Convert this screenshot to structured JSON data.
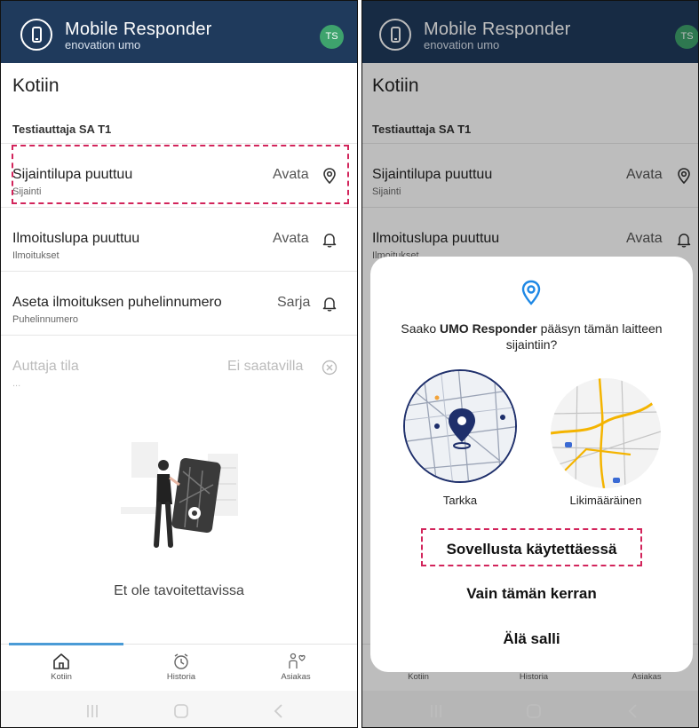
{
  "header": {
    "app_title": "Mobile Responder",
    "app_subtitle": "enovation umo",
    "avatar_initials": "TS",
    "bg_color": "#1f3a5c",
    "avatar_color": "#3ea36d"
  },
  "page": {
    "title": "Kotiin",
    "section_label": "Testiauttaja SA T1"
  },
  "rows": [
    {
      "title": "Sijaintilupa puuttuu",
      "subtitle": "Sijainti",
      "action": "Avata",
      "icon": "location-pin-icon"
    },
    {
      "title": "Ilmoituslupa puuttuu",
      "subtitle": "Ilmoitukset",
      "action": "Avata",
      "icon": "bell-icon"
    },
    {
      "title": "Aseta ilmoituksen puhelinnumero",
      "subtitle": "Puhelinnumero",
      "action": "Sarja",
      "icon": "bell-icon"
    },
    {
      "title": "Auttaja tila",
      "subtitle": "...",
      "action": "Ei saatavilla",
      "icon": "circle-x-icon",
      "disabled": true
    }
  ],
  "empty_state": {
    "text": "Et ole tavoitettavissa"
  },
  "bottom_nav": [
    {
      "label": "Kotiin",
      "icon": "home-icon",
      "active": true
    },
    {
      "label": "Historia",
      "icon": "clock-icon"
    },
    {
      "label": "Asiakas",
      "icon": "client-icon"
    }
  ],
  "permission_dialog": {
    "question_prefix": "Saako ",
    "app_name": "UMO Responder",
    "question_suffix": " pääsyn tämän laitteen sijaintiin?",
    "precise_label": "Tarkka",
    "approximate_label": "Likimääräinen",
    "options": [
      "Sovellusta käytettäessä",
      "Vain tämän kerran",
      "Älä salli"
    ],
    "accent_color": "#1e88e5"
  },
  "highlight_color": "#d2245b"
}
